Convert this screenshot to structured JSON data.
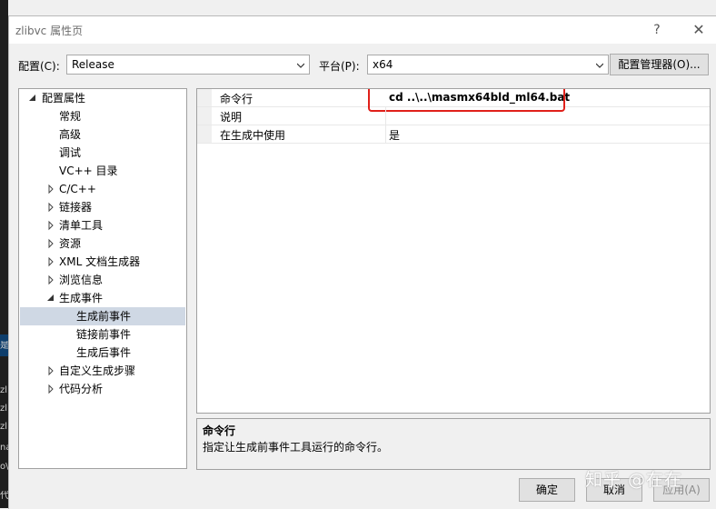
{
  "background": {
    "lines": [
      "是",
      "zl",
      "zl",
      "zl",
      "na",
      "o\\",
      "代"
    ],
    "accent": "#1e1e1e"
  },
  "dialog": {
    "title": "zlibvc 属性页",
    "help_icon": "question-icon",
    "close_icon": "close-icon"
  },
  "config_bar": {
    "config_label": "配置(C):",
    "config_value": "Release",
    "platform_label": "平台(P):",
    "platform_value": "x64",
    "manager_button": "配置管理器(O)..."
  },
  "tree": {
    "items": [
      {
        "label": "配置属性",
        "twisty": "expanded"
      },
      {
        "label": "常规",
        "twisty": ""
      },
      {
        "label": "高级",
        "twisty": ""
      },
      {
        "label": "调试",
        "twisty": ""
      },
      {
        "label": "VC++ 目录",
        "twisty": ""
      },
      {
        "label": "C/C++",
        "twisty": "collapsed"
      },
      {
        "label": "链接器",
        "twisty": "collapsed"
      },
      {
        "label": "清单工具",
        "twisty": "collapsed"
      },
      {
        "label": "资源",
        "twisty": "collapsed"
      },
      {
        "label": "XML 文档生成器",
        "twisty": "collapsed"
      },
      {
        "label": "浏览信息",
        "twisty": "collapsed"
      },
      {
        "label": "生成事件",
        "twisty": "expanded"
      },
      {
        "label": "生成前事件",
        "twisty": "",
        "selected": true
      },
      {
        "label": "链接前事件",
        "twisty": ""
      },
      {
        "label": "生成后事件",
        "twisty": ""
      },
      {
        "label": "自定义生成步骤",
        "twisty": "collapsed"
      },
      {
        "label": "代码分析",
        "twisty": "collapsed"
      }
    ]
  },
  "grid": {
    "rows": [
      {
        "name": "命令行",
        "value": "cd ..\\..\\masmx64bld_ml64.bat"
      },
      {
        "name": "说明",
        "value": ""
      },
      {
        "name": "在生成中使用",
        "value": "是"
      }
    ],
    "highlight_color": "#e0201a"
  },
  "description": {
    "title": "命令行",
    "text": "指定让生成前事件工具运行的命令行。"
  },
  "footer": {
    "ok": "确定",
    "cancel": "取消",
    "apply": "应用(A)"
  },
  "watermark": "知乎 @在在",
  "colors": {
    "selection": "#cfd8e4",
    "window": "#f0f0f0",
    "button": "#e1e1e1"
  }
}
